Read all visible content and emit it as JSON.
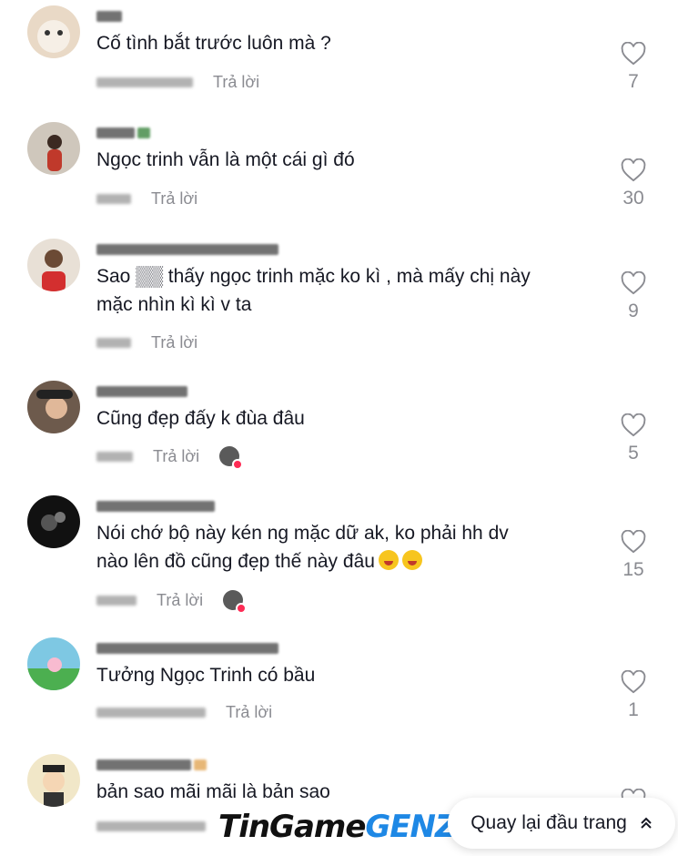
{
  "comments": [
    {
      "text": "Cố tình bắt trước luôn mà ?",
      "reply_label": "Trả lời",
      "likes": "7"
    },
    {
      "text": "Ngọc trinh vẫn là một cái gì đó",
      "reply_label": "Trả lời",
      "likes": "30"
    },
    {
      "text": "Sao ▒▒ thấy ngọc trinh mặc ko kì , mà mấy chị này\nmặc nhìn kì kì v ta",
      "reply_label": "Trả lời",
      "likes": "9"
    },
    {
      "text": "Cũng đẹp đấy k đùa đâu",
      "reply_label": "Trả lời",
      "likes": "5"
    },
    {
      "text": "Nói chớ bộ này kén ng mặc dữ ak, ko phải hh dv\nnào lên đồ cũng đẹp thế này đâu",
      "reply_label": "Trả lời",
      "likes": "15"
    },
    {
      "text": "Tưởng Ngọc Trinh có bầu",
      "reply_label": "Trả lời",
      "likes": "1"
    },
    {
      "text": "bản sao mãi mãi là bản sao",
      "reply_label": "",
      "likes": ""
    }
  ],
  "back_to_top": {
    "label": "Quay lại đầu trang",
    "icon": "double-chevron-up-icon"
  },
  "watermark": {
    "part1": "TinGame",
    "part2": "GENZ"
  },
  "colors": {
    "accent": "#fe2c55",
    "muted": "#8a8b91",
    "text": "#161823"
  }
}
